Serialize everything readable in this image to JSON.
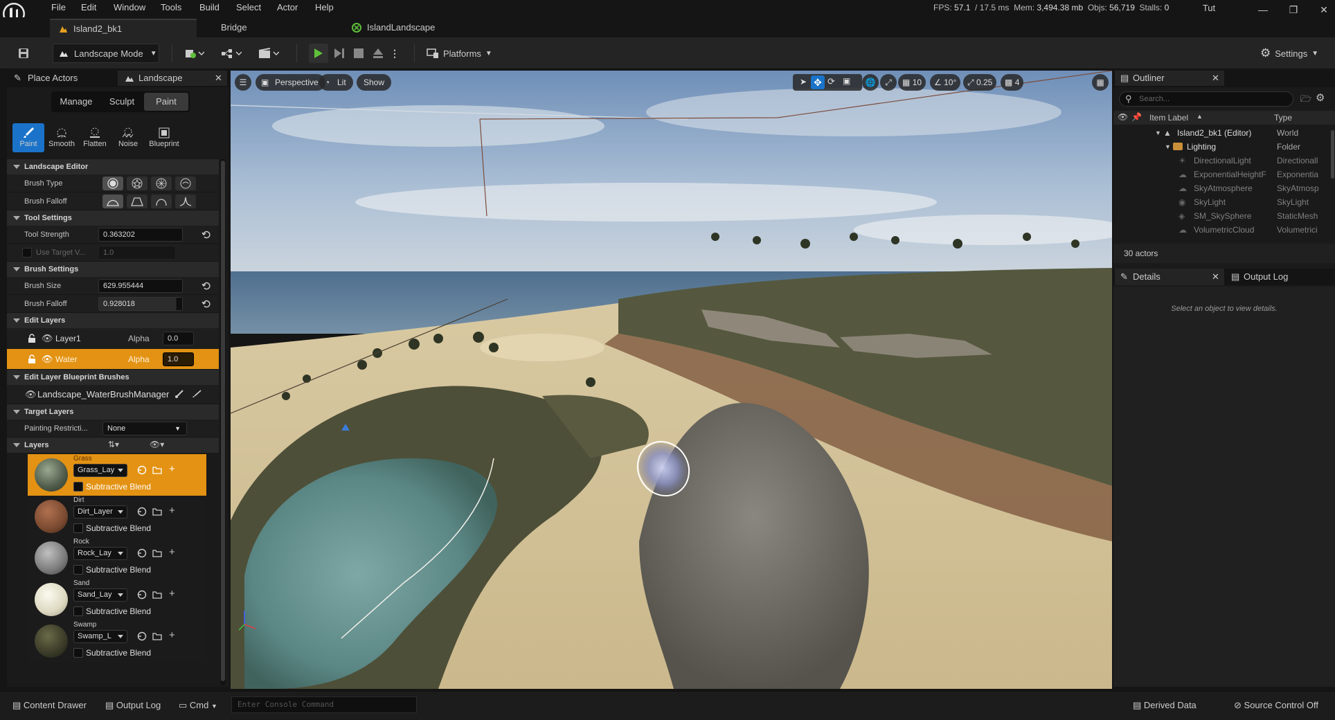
{
  "menu": [
    "File",
    "Edit",
    "Window",
    "Tools",
    "Build",
    "Select",
    "Actor",
    "Help"
  ],
  "stats": {
    "fps_label": "FPS:",
    "fps": "57.1",
    "ms": "/ 17.5 ms",
    "mem_label": "Mem:",
    "mem": "3,494.38 mb",
    "objs_label": "Objs:",
    "objs": "56,719",
    "stalls_label": "Stalls:",
    "stalls": "0"
  },
  "user": "Tut",
  "tabs": [
    {
      "label": "Island2_bk1"
    },
    {
      "label": "Bridge"
    },
    {
      "label": "IslandLandscape"
    }
  ],
  "toolbar": {
    "mode": "Landscape Mode",
    "platforms": "Platforms",
    "settings": "Settings"
  },
  "left_panel": {
    "tabs": [
      "Place Actors",
      "Landscape"
    ],
    "modes": [
      "Manage",
      "Sculpt",
      "Paint"
    ],
    "tools": [
      "Paint",
      "Smooth",
      "Flatten",
      "Noise",
      "Blueprint"
    ],
    "sections": {
      "landscape_editor": "Landscape Editor",
      "tool_settings": "Tool Settings",
      "brush_settings": "Brush Settings",
      "edit_layers": "Edit Layers",
      "blueprint_brushes": "Edit Layer Blueprint Brushes",
      "target_layers": "Target Layers",
      "layers": "Layers"
    },
    "brush_type_label": "Brush Type",
    "brush_falloff_label": "Brush Falloff",
    "tool_strength_label": "Tool Strength",
    "tool_strength": "0.363202",
    "use_target_label": "Use Target V...",
    "use_target": "1.0",
    "brush_size_label": "Brush Size",
    "brush_size": "629.955444",
    "brush_falloff_value_label": "Brush Falloff",
    "brush_falloff": "0.928018",
    "edit_layers": [
      {
        "name": "Layer1",
        "alpha_label": "Alpha",
        "alpha": "0.0"
      },
      {
        "name": "Water",
        "alpha_label": "Alpha",
        "alpha": "1.0"
      }
    ],
    "blueprint_brush": "Landscape_WaterBrushManager",
    "painting_restriction_label": "Painting Restricti...",
    "painting_restriction": "None",
    "paint_layers": [
      {
        "name": "Grass",
        "asset": "Grass_Lay",
        "blend": "Subtractive Blend",
        "color": "#5a6a48"
      },
      {
        "name": "Dirt",
        "asset": "Dirt_Layer",
        "blend": "Subtractive Blend",
        "color": "#7a4a30"
      },
      {
        "name": "Rock",
        "asset": "Rock_Lay",
        "blend": "Subtractive Blend",
        "color": "#808080"
      },
      {
        "name": "Sand",
        "asset": "Sand_Lay",
        "blend": "Subtractive Blend",
        "color": "#e8e4d0"
      },
      {
        "name": "Swamp",
        "asset": "Swamp_L",
        "blend": "Subtractive Blend",
        "color": "#3a3a28"
      }
    ]
  },
  "viewport": {
    "perspective": "Perspective",
    "lit": "Lit",
    "show": "Show",
    "grid": "10",
    "angle": "10°",
    "scale": "0.25",
    "camera_speed": "4"
  },
  "outliner": {
    "title": "Outliner",
    "search_placeholder": "Search...",
    "col_label": "Item Label",
    "col_type": "Type",
    "rows": [
      {
        "label": "Island2_bk1 (Editor)",
        "type": "World"
      },
      {
        "label": "Lighting",
        "type": "Folder"
      },
      {
        "label": "DirectionalLight",
        "type": "Directionall"
      },
      {
        "label": "ExponentialHeightF",
        "type": "Exponentia"
      },
      {
        "label": "SkyAtmosphere",
        "type": "SkyAtmosp"
      },
      {
        "label": "SkyLight",
        "type": "SkyLight"
      },
      {
        "label": "SM_SkySphere",
        "type": "StaticMesh"
      },
      {
        "label": "VolumetricCloud",
        "type": "Volumetrici"
      }
    ],
    "count": "30 actors"
  },
  "details": {
    "tab": "Details",
    "output_tab": "Output Log",
    "hint": "Select an object to view details."
  },
  "bottom": {
    "content_drawer": "Content Drawer",
    "output_log": "Output Log",
    "cmd": "Cmd",
    "console_placeholder": "Enter Console Command",
    "derived_data": "Derived Data",
    "source_control": "Source Control Off"
  },
  "colors": {
    "accent": "#e39213",
    "selected_blue": "#1a73c9",
    "panel": "#1a1a1a"
  }
}
